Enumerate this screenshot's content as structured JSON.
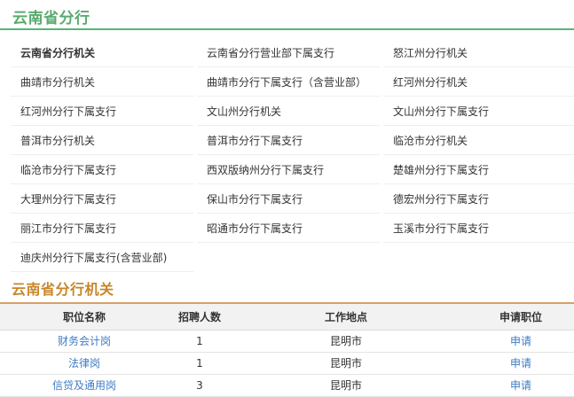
{
  "header": {
    "title": "云南省分行"
  },
  "branches": [
    {
      "label": "云南省分行机关",
      "bold": true
    },
    {
      "label": "云南省分行营业部下属支行"
    },
    {
      "label": "怒江州分行机关"
    },
    {
      "label": "曲靖市分行机关"
    },
    {
      "label": "曲靖市分行下属支行（含营业部）"
    },
    {
      "label": "红河州分行机关"
    },
    {
      "label": "红河州分行下属支行"
    },
    {
      "label": "文山州分行机关"
    },
    {
      "label": "文山州分行下属支行"
    },
    {
      "label": "普洱市分行机关"
    },
    {
      "label": "普洱市分行下属支行"
    },
    {
      "label": "临沧市分行机关"
    },
    {
      "label": "临沧市分行下属支行"
    },
    {
      "label": "西双版纳州分行下属支行"
    },
    {
      "label": "楚雄州分行下属支行"
    },
    {
      "label": "大理州分行下属支行"
    },
    {
      "label": "保山市分行下属支行"
    },
    {
      "label": "德宏州分行下属支行"
    },
    {
      "label": "丽江市分行下属支行"
    },
    {
      "label": "昭通市分行下属支行"
    },
    {
      "label": "玉溪市分行下属支行"
    },
    {
      "label": "迪庆州分行下属支行(含营业部)"
    }
  ],
  "section": {
    "title": "云南省分行机关"
  },
  "table": {
    "columns": [
      "职位名称",
      "招聘人数",
      "工作地点",
      "申请职位"
    ],
    "rows": [
      {
        "position": "财务会计岗",
        "count": "1",
        "location": "昆明市",
        "apply": "申请"
      },
      {
        "position": "法律岗",
        "count": "1",
        "location": "昆明市",
        "apply": "申请"
      },
      {
        "position": "信贷及通用岗",
        "count": "3",
        "location": "昆明市",
        "apply": "申请"
      }
    ]
  },
  "colors": {
    "header_accent": "#5aaa6f",
    "section_accent": "#c8862a",
    "link": "#3f7cc4"
  }
}
